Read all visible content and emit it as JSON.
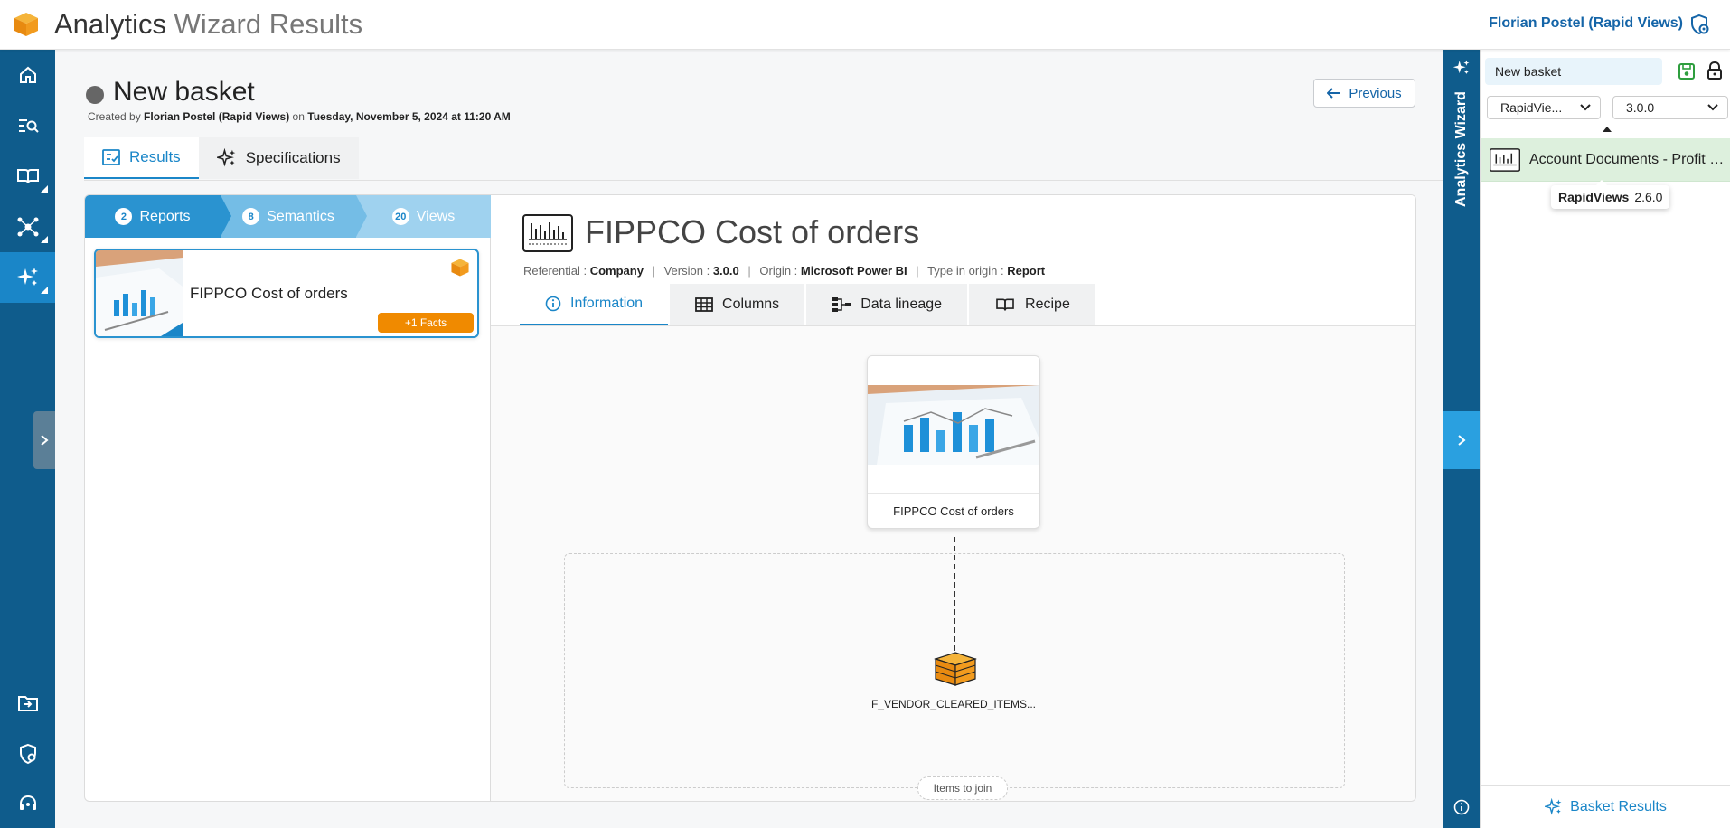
{
  "header": {
    "title_part1": "Analytics",
    "title_part2": "Wizard Results",
    "user": "Florian Postel (Rapid Views)"
  },
  "basket": {
    "name": "New basket",
    "created_prefix": "Created by",
    "created_by": "Florian Postel (Rapid Views)",
    "created_on_word": "on",
    "created_on": "Tuesday, November 5, 2024 at 11:20 AM",
    "previous_label": "Previous"
  },
  "main_tabs": [
    {
      "label": "Results",
      "active": true
    },
    {
      "label": "Specifications",
      "active": false
    }
  ],
  "steps": [
    {
      "count": "2",
      "label": "Reports"
    },
    {
      "count": "8",
      "label": "Semantics"
    },
    {
      "count": "20",
      "label": "Views"
    }
  ],
  "report_card": {
    "name": "FIPPCO Cost of orders",
    "badge": "+1 Facts"
  },
  "report": {
    "title": "FIPPCO Cost of orders",
    "referential_label": "Referential :",
    "referential": "Company",
    "version_label": "Version :",
    "version": "3.0.0",
    "origin_label": "Origin :",
    "origin": "Microsoft Power BI",
    "type_label": "Type in origin :",
    "type": "Report"
  },
  "sub_tabs": [
    {
      "label": "Information",
      "active": true
    },
    {
      "label": "Columns",
      "active": false
    },
    {
      "label": "Data lineage",
      "active": false
    },
    {
      "label": "Recipe",
      "active": false
    }
  ],
  "lineage": {
    "card_label": "FIPPCO Cost of orders",
    "cube_label": "F_VENDOR_CLEARED_ITEMS...",
    "join_label": "Items to join"
  },
  "wizard": {
    "title": "Analytics Wizard",
    "basket_value": "New basket",
    "product_select": "RapidVie...",
    "version_select": "3.0.0",
    "item": "Account Documents - Profit Center",
    "tooltip_product": "RapidViews",
    "tooltip_version": "2.6.0",
    "footer": "Basket Results"
  },
  "colors": {
    "nav": "#0f5c8c",
    "accent": "#1a86c8",
    "badge": "#f08a00",
    "item_bg": "#ddf0dd"
  }
}
